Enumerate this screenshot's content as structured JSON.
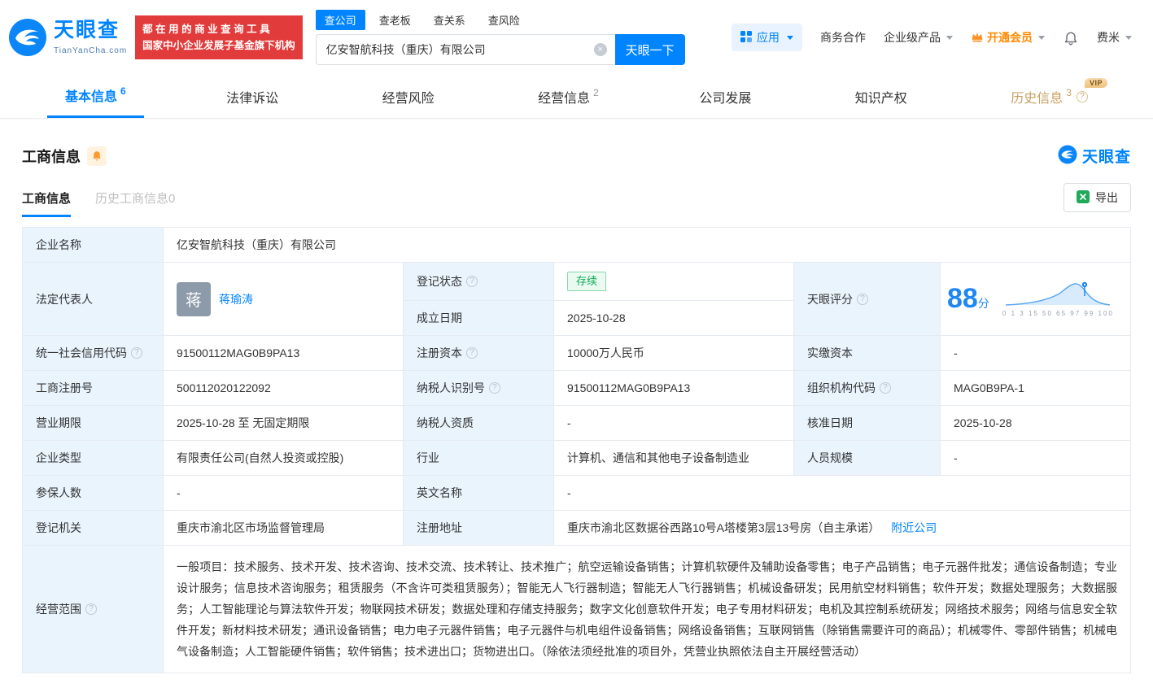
{
  "colors": {
    "primary": "#0084ff",
    "slogan_red": "#e23b3b",
    "vip_orange": "#ff8a00",
    "history_gold": "#c9a063",
    "status_green": "#0fa958",
    "label_bg": "#e9f4fd"
  },
  "brand": {
    "name": "天眼查",
    "domain": "TianYanCha.com"
  },
  "slogan": {
    "line1": "都在用的商业查询工具",
    "line2": "国家中小企业发展子基金旗下机构"
  },
  "search": {
    "tabs": [
      {
        "label": "查公司"
      },
      {
        "label": "查老板"
      },
      {
        "label": "查关系"
      },
      {
        "label": "查风险"
      }
    ],
    "value": "亿安智航科技（重庆）有限公司",
    "button": "天眼一下"
  },
  "topnav": {
    "apps": "应用",
    "cooperation": "商务合作",
    "enterprise": "企业级产品",
    "vip": "开通会员",
    "user": "费米"
  },
  "tabs": [
    {
      "label": "基本信息",
      "count": "6"
    },
    {
      "label": "法律诉讼",
      "count": ""
    },
    {
      "label": "经营风险",
      "count": ""
    },
    {
      "label": "经营信息",
      "count": "2"
    },
    {
      "label": "公司发展",
      "count": ""
    },
    {
      "label": "知识产权",
      "count": ""
    },
    {
      "label": "历史信息",
      "count": "3",
      "badge": "VIP"
    }
  ],
  "section": {
    "title": "工商信息",
    "brand": "天眼查",
    "tab_current": "工商信息",
    "tab_history": "历史工商信息0",
    "export_label": "导出"
  },
  "fields": {
    "name": {
      "label": "企业名称",
      "value": "亿安智航科技（重庆）有限公司"
    },
    "legal": {
      "label": "法定代表人",
      "avatar": "蒋",
      "value": "蒋瑜涛"
    },
    "status": {
      "label": "登记状态",
      "value": "存续"
    },
    "established": {
      "label": "成立日期",
      "value": "2025-10-28"
    },
    "score": {
      "label": "天眼评分",
      "value": "88",
      "unit": "分",
      "ticks": "0 1 3 15 50 65 97 99 100"
    },
    "uscc": {
      "label": "统一社会信用代码",
      "value": "91500112MAG0B9PA13"
    },
    "capital": {
      "label": "注册资本",
      "value": "10000万人民币"
    },
    "paid_capital": {
      "label": "实缴资本",
      "value": "-"
    },
    "reg_no": {
      "label": "工商注册号",
      "value": "500112020122092"
    },
    "tax_no": {
      "label": "纳税人识别号",
      "value": "91500112MAG0B9PA13"
    },
    "org_code": {
      "label": "组织机构代码",
      "value": "MAG0B9PA-1"
    },
    "term": {
      "label": "营业期限",
      "value": "2025-10-28 至 无固定期限"
    },
    "tax_qualification": {
      "label": "纳税人资质",
      "value": "-"
    },
    "approval_date": {
      "label": "核准日期",
      "value": "2025-10-28"
    },
    "company_type": {
      "label": "企业类型",
      "value": "有限责任公司(自然人投资或控股)"
    },
    "industry": {
      "label": "行业",
      "value": "计算机、通信和其他电子设备制造业"
    },
    "staff_size": {
      "label": "人员规模",
      "value": "-"
    },
    "insured_count": {
      "label": "参保人数",
      "value": "-"
    },
    "english_name": {
      "label": "英文名称",
      "value": "-"
    },
    "registry": {
      "label": "登记机关",
      "value": "重庆市渝北区市场监督管理局"
    },
    "address": {
      "label": "注册地址",
      "value": "重庆市渝北区数据谷西路10号A塔楼第3层13号房（自主承诺）",
      "link": "附近公司"
    },
    "scope": {
      "label": "经营范围",
      "value": "一般项目：技术服务、技术开发、技术咨询、技术交流、技术转让、技术推广；航空运输设备销售；计算机软硬件及辅助设备零售；电子产品销售；电子元器件批发；通信设备制造；专业设计服务；信息技术咨询服务；租赁服务（不含许可类租赁服务）；智能无人飞行器制造；智能无人飞行器销售；机械设备研发；民用航空材料销售；软件开发；数据处理服务；大数据服务；人工智能理论与算法软件开发；物联网技术研发；数据处理和存储支持服务；数字文化创意软件开发；电子专用材料研发；电机及其控制系统研发；网络技术服务；网络与信息安全软件开发；新材料技术研发；通讯设备销售；电力电子元器件销售；电子元器件与机电组件设备销售；网络设备销售；互联网销售（除销售需要许可的商品）；机械零件、零部件销售；机械电气设备制造；人工智能硬件销售；软件销售；技术进出口；货物进出口。（除依法须经批准的项目外，凭营业执照依法自主开展经营活动）"
    }
  }
}
